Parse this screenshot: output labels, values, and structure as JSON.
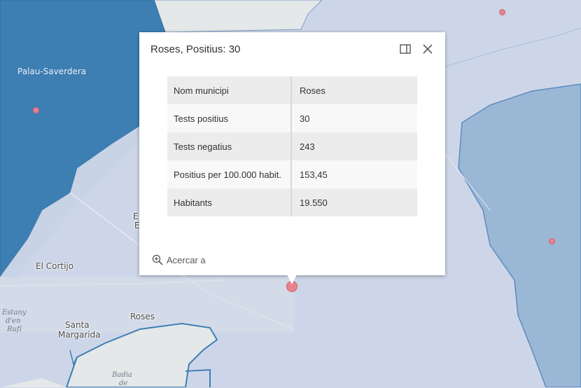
{
  "map": {
    "labels": {
      "palau": "Palau-Saverdera",
      "el_cortijo": "El Cortijo",
      "roses": "Roses",
      "santa_margarida_1": "Santa",
      "santa_margarida_2": "Margarida",
      "estany_1": "Estany",
      "estany_2": "d'en",
      "estany_3": "Rufí",
      "badia_1": "Badia",
      "badia_2": "de",
      "partial_1": "E",
      "partial_2": "E"
    },
    "colors": {
      "dark_region": "#3e7fb3",
      "light_region": "#9ab7d6",
      "base_region": "#cdd6e8",
      "land": "#e4e8e8",
      "marker": "#e8828e"
    }
  },
  "popup": {
    "title": "Roses, Positius: 30",
    "dock_icon": "dock-icon",
    "close_icon": "close-icon",
    "rows": [
      {
        "key": "Nom municipi",
        "value": "Roses"
      },
      {
        "key": "Tests positius",
        "value": "30"
      },
      {
        "key": "Tests negatius",
        "value": "243"
      },
      {
        "key": "Positius per 100.000 habit.",
        "value": "153,45"
      },
      {
        "key": "Habitants",
        "value": "19.550"
      }
    ],
    "zoom_label": "Acercar a",
    "zoom_icon": "zoom-in-icon"
  }
}
